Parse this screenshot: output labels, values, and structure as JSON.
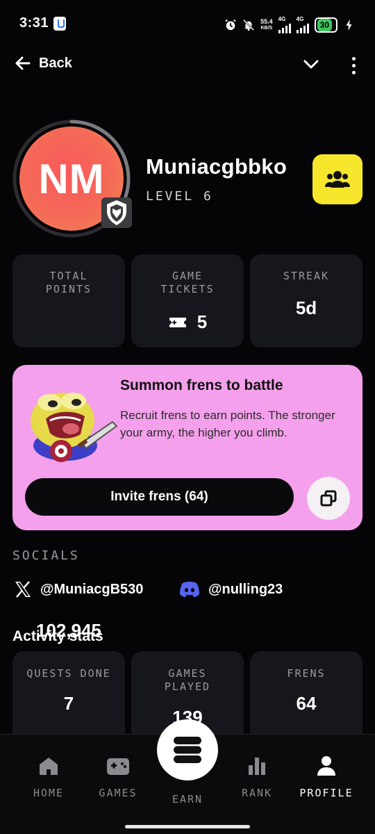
{
  "status_bar": {
    "time": "3:31",
    "net_speed_value": "55.4",
    "net_speed_unit": "KB/S",
    "signal1_label": "4G",
    "signal2_label": "4G",
    "battery": "30"
  },
  "nav": {
    "back_label": "Back"
  },
  "profile": {
    "initials": "NM",
    "username": "Muniacgbbko",
    "level": "LEVEL 6",
    "avatar_progress": 0.35
  },
  "stats": [
    {
      "label_line1": "TOTAL",
      "label_line2": "POINTS",
      "value": "102,945"
    },
    {
      "label_line1": "GAME",
      "label_line2": "TICKETS",
      "value": "5"
    },
    {
      "label_line1": "STREAK",
      "label_line2": "",
      "value": "5d"
    }
  ],
  "promo": {
    "title": "Summon frens to battle",
    "description": "Recruit frens to earn points. The stronger your army, the higher you climb.",
    "invite_label": "Invite frens (64)"
  },
  "socials": {
    "title": "SOCIALS",
    "x_handle": "@MuniacgB530",
    "discord_handle": "@nulling23"
  },
  "activity": {
    "title": "Activity stats",
    "items": [
      {
        "label_line1": "QUESTS DONE",
        "label_line2": "",
        "value": "7"
      },
      {
        "label_line1": "GAMES",
        "label_line2": "PLAYED",
        "value": "139"
      },
      {
        "label_line1": "FRENS",
        "label_line2": "",
        "value": "64"
      }
    ]
  },
  "bottom_nav": {
    "items": [
      {
        "label": "HOME",
        "icon": "home-icon"
      },
      {
        "label": "GAMES",
        "icon": "gamepad-icon"
      },
      {
        "label": "EARN",
        "icon": "stack-icon"
      },
      {
        "label": "RANK",
        "icon": "bar-chart-icon"
      },
      {
        "label": "PROFILE",
        "icon": "user-icon"
      }
    ],
    "active": "PROFILE"
  },
  "colors": {
    "background": "#050507",
    "card": "#16171c",
    "promo": "#f5a0ec",
    "frens_button": "#f7e72c",
    "avatar": "#f46a57",
    "discord": "#5865f2",
    "battery": "#3ec55e"
  }
}
